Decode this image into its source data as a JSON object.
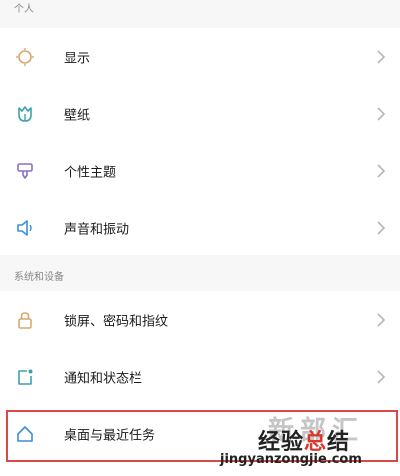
{
  "sections": {
    "personal": {
      "title": "个人",
      "items": [
        {
          "label": "显示",
          "icon": "sun-icon"
        },
        {
          "label": "壁纸",
          "icon": "tulip-icon"
        },
        {
          "label": "个性主题",
          "icon": "paint-brush-icon"
        },
        {
          "label": "声音和振动",
          "icon": "speaker-icon"
        }
      ]
    },
    "system": {
      "title": "系统和设备",
      "items": [
        {
          "label": "锁屏、密码和指纹",
          "icon": "lock-icon"
        },
        {
          "label": "通知和状态栏",
          "icon": "notification-icon"
        },
        {
          "label": "桌面与最近任务",
          "icon": "home-icon"
        }
      ]
    }
  },
  "watermark": {
    "line1_prefix": "新",
    "line1_rest": "部汇",
    "main_prefix": "经验",
    "main_accent": "总",
    "main_suffix": "结",
    "site": "jingyanzongjie.com"
  },
  "colors": {
    "icon_accent": "#d9a86c",
    "icon_teal": "#3ba3a8",
    "icon_purple": "#8a6fc7",
    "icon_blue": "#3c8fd8",
    "highlight_border": "#d84a4a",
    "chevron": "#b5b5b5"
  }
}
